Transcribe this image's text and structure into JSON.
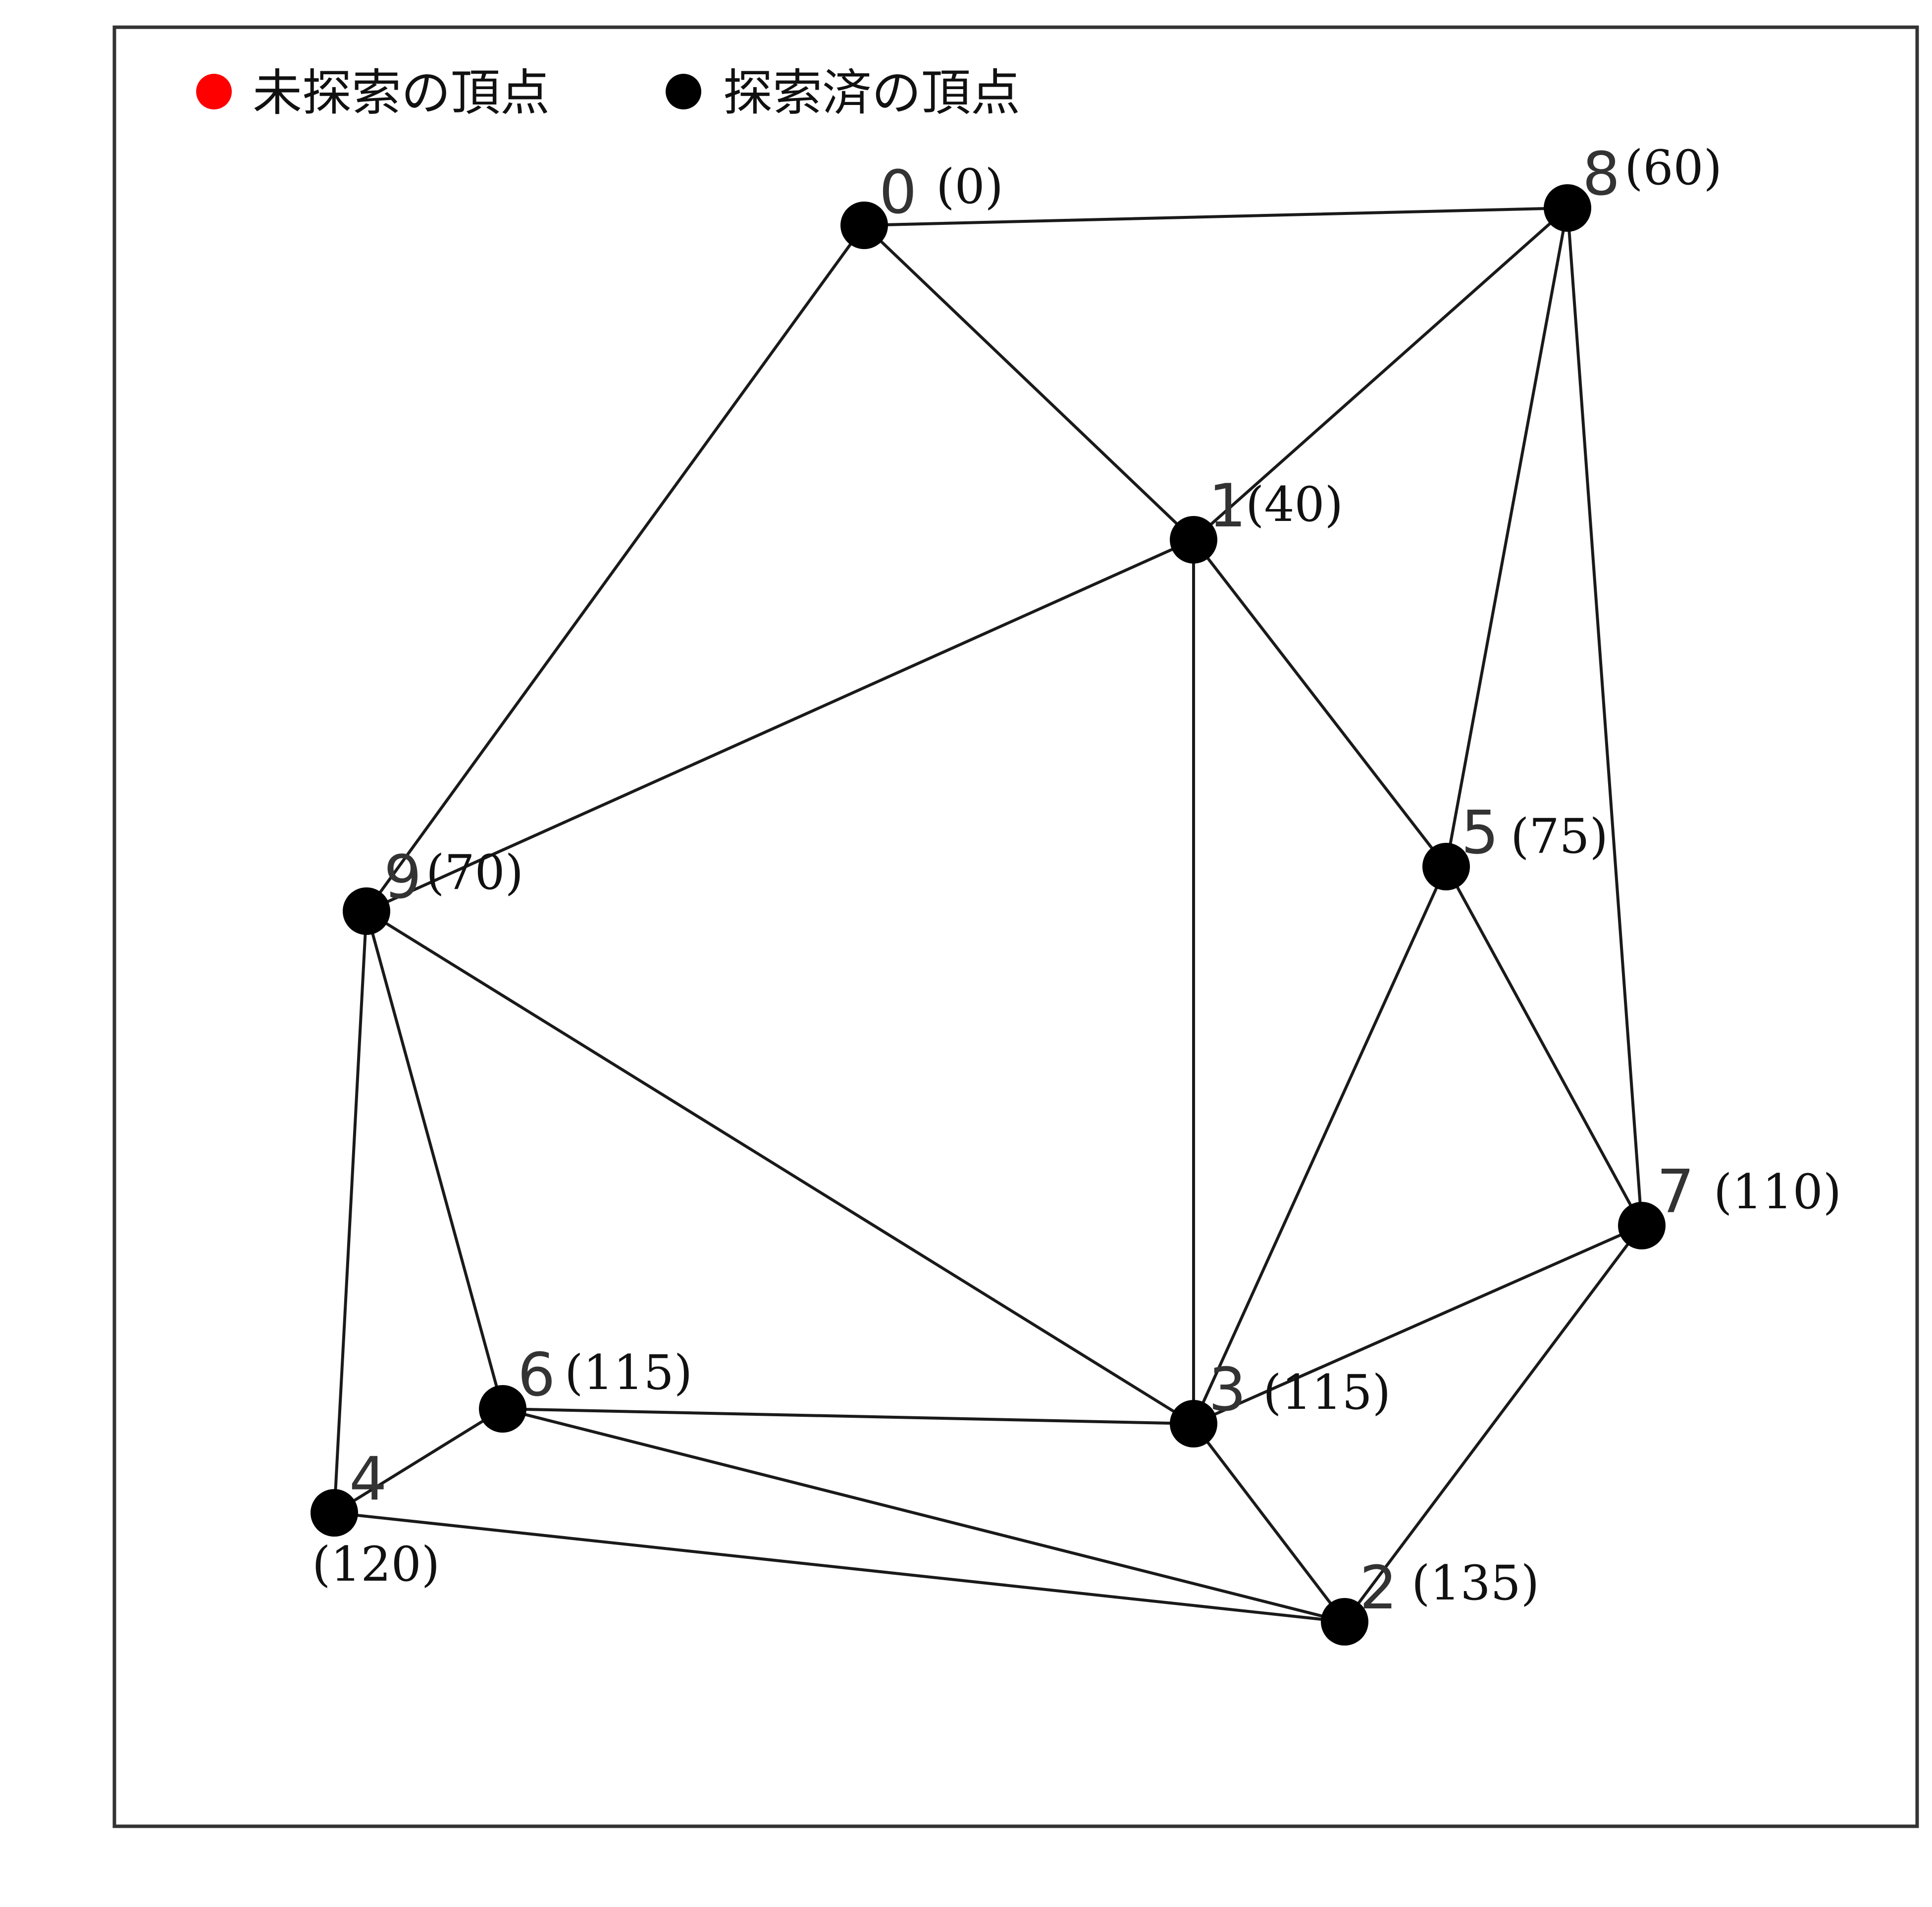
{
  "legend": {
    "items": [
      {
        "label": "未探索の頂点",
        "color": "#ff0000"
      },
      {
        "label": "探索済の頂点",
        "color": "#000000"
      }
    ]
  },
  "graph": {
    "nodes": [
      {
        "id": "0",
        "dist": "(0)",
        "state": "visited"
      },
      {
        "id": "1",
        "dist": "(40)",
        "state": "visited"
      },
      {
        "id": "2",
        "dist": "(135)",
        "state": "visited"
      },
      {
        "id": "3",
        "dist": "(115)",
        "state": "visited"
      },
      {
        "id": "4",
        "dist": "(120)",
        "state": "visited"
      },
      {
        "id": "5",
        "dist": "(75)",
        "state": "visited"
      },
      {
        "id": "6",
        "dist": "(115)",
        "state": "visited"
      },
      {
        "id": "7",
        "dist": "(110)",
        "state": "visited"
      },
      {
        "id": "8",
        "dist": "(60)",
        "state": "visited"
      },
      {
        "id": "9",
        "dist": "(70)",
        "state": "visited"
      }
    ],
    "edges": [
      [
        "0",
        "8"
      ],
      [
        "0",
        "1"
      ],
      [
        "0",
        "9"
      ],
      [
        "8",
        "1"
      ],
      [
        "8",
        "5"
      ],
      [
        "8",
        "7"
      ],
      [
        "1",
        "9"
      ],
      [
        "1",
        "3"
      ],
      [
        "1",
        "5"
      ],
      [
        "5",
        "3"
      ],
      [
        "5",
        "7"
      ],
      [
        "9",
        "3"
      ],
      [
        "9",
        "6"
      ],
      [
        "9",
        "4"
      ],
      [
        "7",
        "3"
      ],
      [
        "7",
        "2"
      ],
      [
        "6",
        "3"
      ],
      [
        "6",
        "4"
      ],
      [
        "6",
        "2"
      ],
      [
        "4",
        "2"
      ],
      [
        "3",
        "2"
      ]
    ]
  }
}
